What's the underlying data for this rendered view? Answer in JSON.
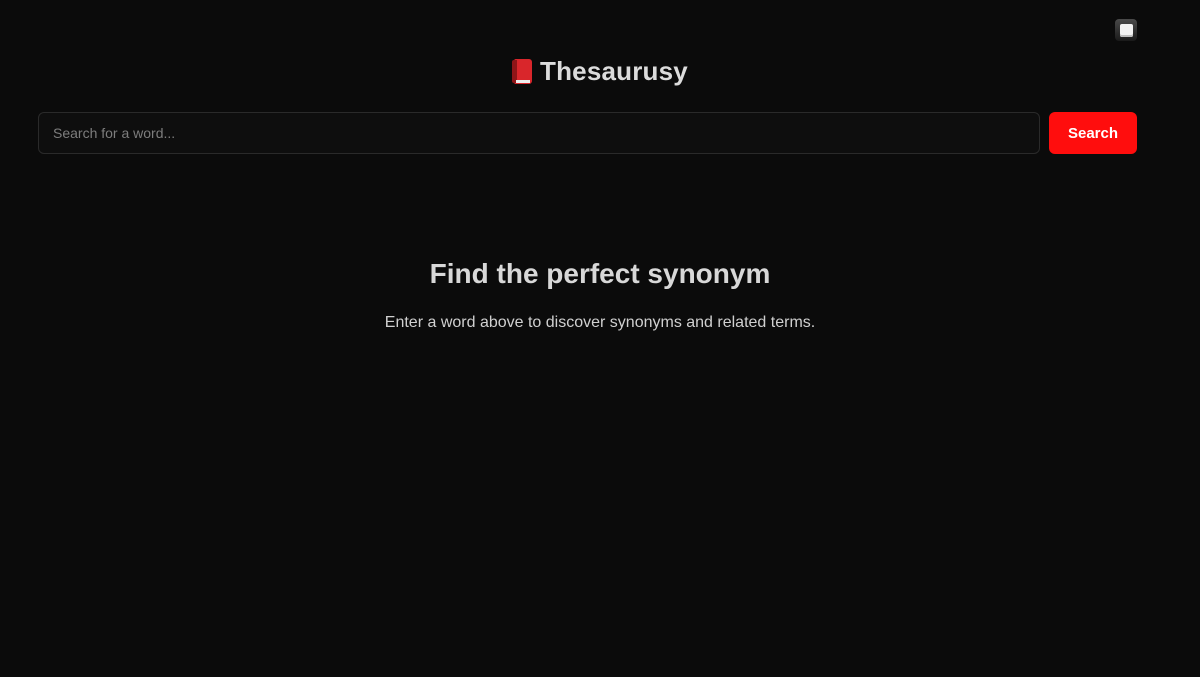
{
  "header": {
    "logo_icon": "red-book-icon",
    "title": "Thesaurusy"
  },
  "theme_toggle": {
    "icon": "white-square-icon"
  },
  "search": {
    "placeholder": "Search for a word...",
    "value": "",
    "button_label": "Search"
  },
  "empty_state": {
    "heading": "Find the perfect synonym",
    "text": "Enter a word above to discover synonyms and related terms."
  },
  "colors": {
    "background": "#0b0b0b",
    "accent": "#ff0d0d",
    "text": "#d6d6d6"
  }
}
